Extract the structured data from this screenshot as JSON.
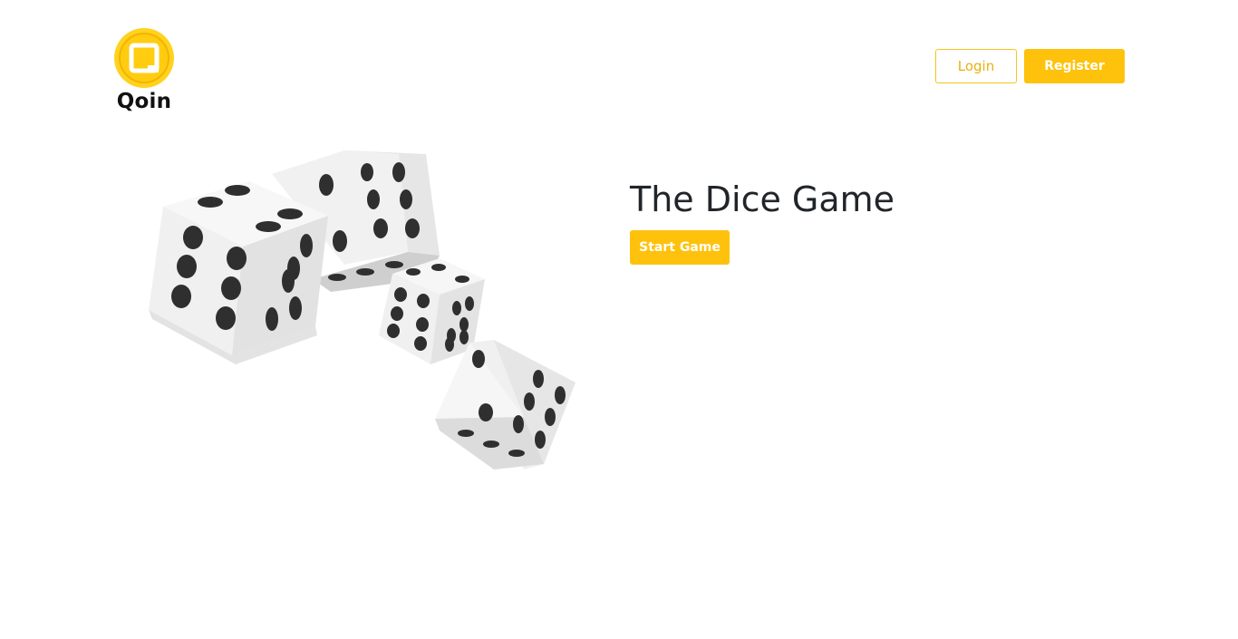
{
  "header": {
    "logo_text": "Qoin",
    "login_label": "Login",
    "register_label": "Register"
  },
  "hero": {
    "title": "The Dice Game",
    "start_label": "Start Game",
    "image": "dice-illustration"
  },
  "colors": {
    "brand_yellow": "#fec20d",
    "login_text": "#e8b112"
  }
}
